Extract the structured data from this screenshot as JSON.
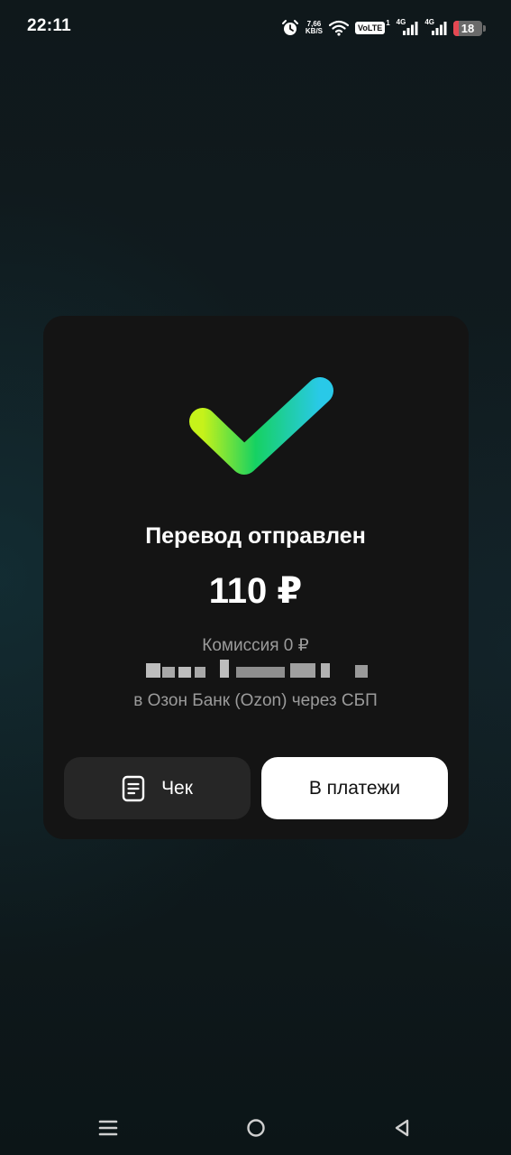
{
  "status_bar": {
    "time": "22:11",
    "net_speed_value": "7,66",
    "net_speed_unit": "KB/S",
    "volte": "VoLTE",
    "volte_sim": "1",
    "network_1": "4G",
    "network_2": "4G",
    "battery_level": "18",
    "battery_low_color": "#e54852"
  },
  "transfer": {
    "title": "Перевод отправлен",
    "amount": "110 ₽",
    "fee": "Комиссия 0 ₽",
    "bank_line": "в Озон Банк (Ozon) через СБП",
    "success_icon": "check-icon",
    "gradient_colors": [
      "#c6f21a",
      "#16d162",
      "#29c9e8"
    ]
  },
  "buttons": {
    "receipt_label": "Чек",
    "receipt_icon": "document-icon",
    "payments_label": "В платежи"
  },
  "nav": {
    "menu_icon": "menu-icon",
    "home_icon": "home-circle-icon",
    "back_icon": "back-triangle-icon"
  }
}
